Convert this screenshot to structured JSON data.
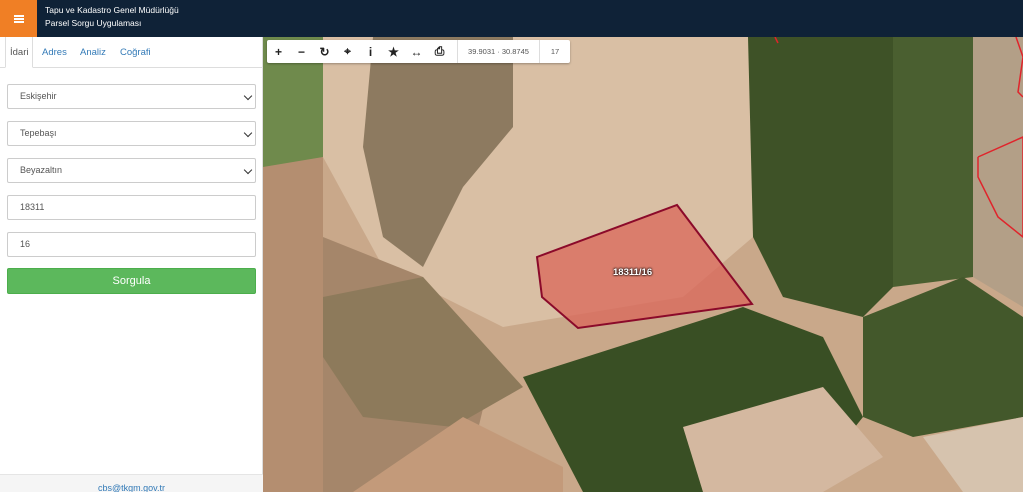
{
  "app": {
    "title_line1": "Tapu ve Kadastro Genel Müdürlüğü",
    "title_line2": "Parsel Sorgu Uygulaması"
  },
  "tabs": [
    {
      "label": "İdari"
    },
    {
      "label": "Adres"
    },
    {
      "label": "Analiz"
    },
    {
      "label": "Coğrafi"
    }
  ],
  "form": {
    "province": "Eskişehir",
    "district": "Tepebaşı",
    "neighborhood": "Beyazaltın",
    "block_no": "18311",
    "parcel_no": "16",
    "submit_label": "Sorgula"
  },
  "footer": {
    "email": "cbs@tkgm.gov.tr"
  },
  "toolbar": {
    "coordinates": "39.9031 · 30.8745",
    "zoom_level": "17"
  },
  "map": {
    "parcel_label": "18311/16",
    "parcel_color": "#8b0a2a",
    "boundary_color": "#e0242b"
  },
  "colors": {
    "header_bg": "#0f2237",
    "menu_accent": "#f07f25",
    "submit_bg": "#5cb85c",
    "link_color": "#337ab7"
  }
}
